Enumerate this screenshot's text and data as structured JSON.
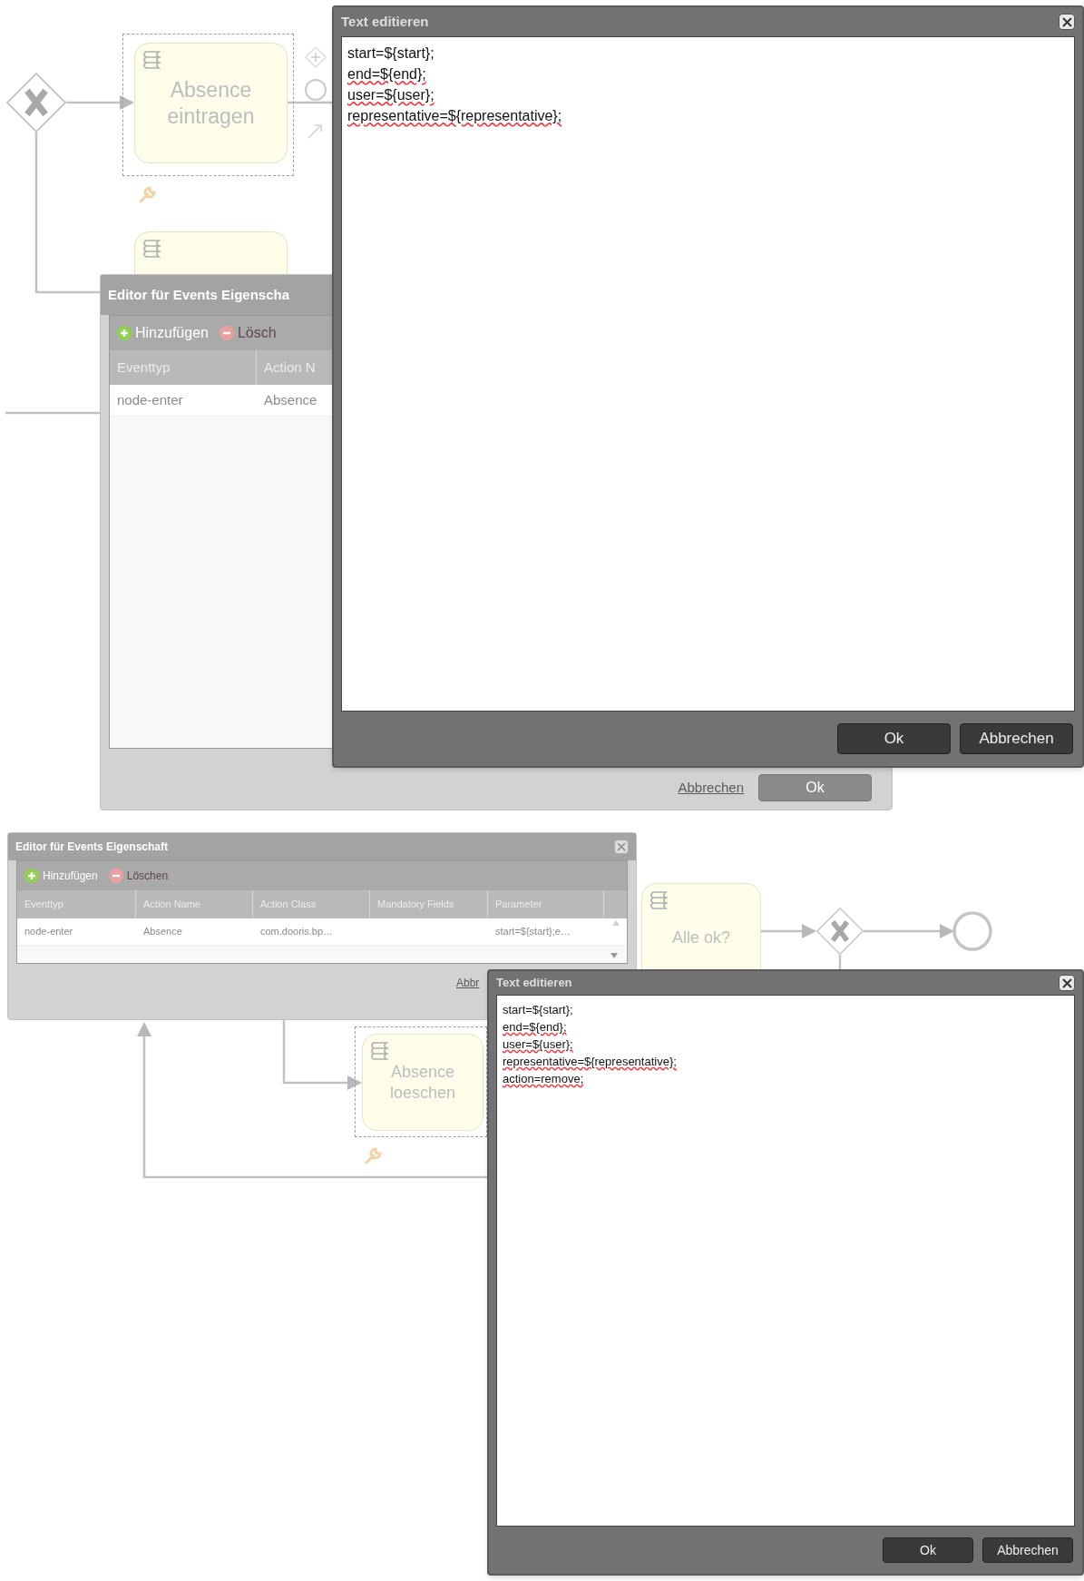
{
  "top": {
    "diagram": {
      "tasks": [
        {
          "label": "Absence eintragen",
          "selected": true
        },
        {
          "selected": false
        }
      ]
    },
    "events_editor": {
      "title": "Editor für Events Eigenscha",
      "toolbar": [
        {
          "label": "Hinzufügen",
          "kind": "add",
          "disabled": false
        },
        {
          "label": "Lösch",
          "kind": "delete",
          "disabled": true
        }
      ],
      "columns": [
        "Eventtyp",
        "Action N"
      ],
      "rows": [
        {
          "cells": [
            "node-enter",
            "Absence"
          ]
        }
      ],
      "cancel": "Abbrechen",
      "ok": "Ok"
    },
    "text_editor": {
      "title": "Text editieren",
      "lines": [
        {
          "text": "start=${start};",
          "misspelled": false
        },
        {
          "text": "end=${end};",
          "misspelled": true
        },
        {
          "text": "user=${user};",
          "misspelled": true
        },
        {
          "text": "representative=${representative};",
          "misspelled": true
        }
      ],
      "ok": "Ok",
      "cancel": "Abbrechen"
    }
  },
  "bottom": {
    "diagram": {
      "tasks": [
        {
          "label": "Alle ok?",
          "selected": false
        },
        {
          "label": "Absence loeschen",
          "selected": true
        }
      ]
    },
    "events_editor": {
      "title": "Editor für Events Eigenschaft",
      "toolbar": [
        {
          "label": "Hinzufügen",
          "kind": "add",
          "disabled": false
        },
        {
          "label": "Löschen",
          "kind": "delete",
          "disabled": true
        }
      ],
      "columns": [
        "Eventtyp",
        "Action Name",
        "Action Class",
        "Mandatory Fields",
        "Parameter"
      ],
      "rows": [
        {
          "cells": [
            "node-enter",
            "Absence",
            "com.dooris.bp…",
            null,
            "start=${start};e…"
          ]
        }
      ],
      "cancel": "Abbr"
    },
    "text_editor": {
      "title": "Text editieren",
      "lines": [
        {
          "text": "start=${start};",
          "misspelled": false
        },
        {
          "text": "end=${end};",
          "misspelled": true
        },
        {
          "text": "user=${user};",
          "misspelled": true
        },
        {
          "text": "representative=${representative};",
          "misspelled": true
        },
        {
          "text": "action=remove;",
          "misspelled": true
        }
      ],
      "ok": "Ok",
      "cancel": "Abbrechen"
    }
  }
}
